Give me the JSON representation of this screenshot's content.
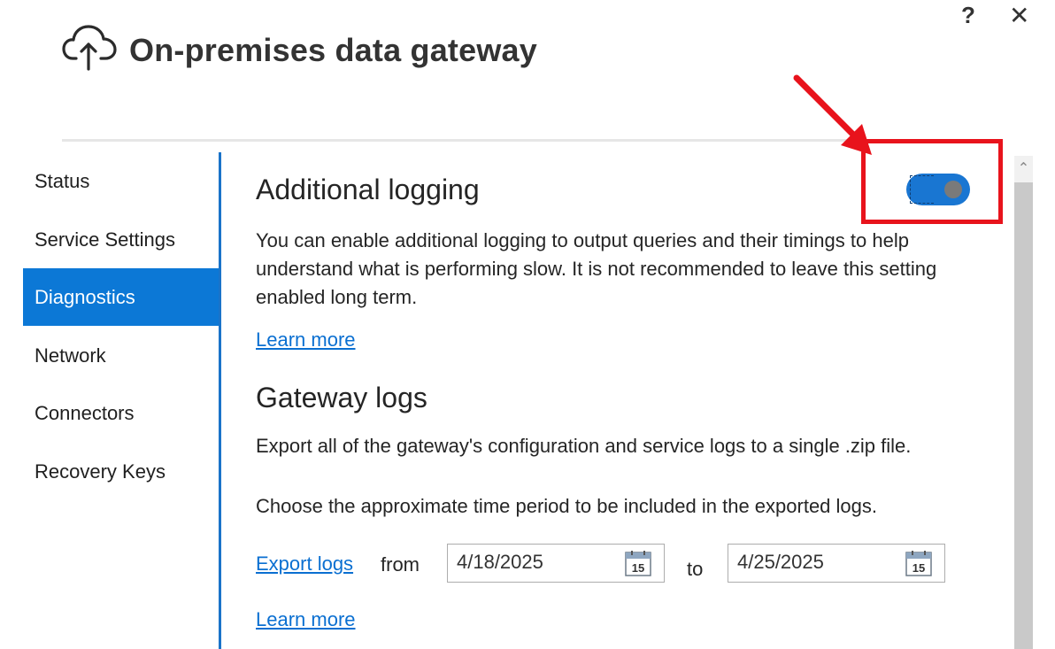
{
  "window": {
    "help_glyph": "?",
    "close_glyph": "✕"
  },
  "header": {
    "title": "On-premises data gateway",
    "icon": "cloud-upload-icon"
  },
  "sidebar": {
    "items": [
      {
        "label": "Status"
      },
      {
        "label": "Service Settings"
      },
      {
        "label": "Diagnostics",
        "active": true
      },
      {
        "label": "Network"
      },
      {
        "label": "Connectors"
      },
      {
        "label": "Recovery Keys"
      }
    ]
  },
  "additional_logging": {
    "title": "Additional logging",
    "description": "You can enable additional logging to output queries and their timings to help understand what is performing slow. It is not recommended to leave this setting enabled long term.",
    "learn_more": "Learn more",
    "toggle_on": true
  },
  "gateway_logs": {
    "title": "Gateway logs",
    "description": "Export all of the gateway's configuration and service logs to a single .zip file.",
    "period_hint": "Choose the approximate time period to be included in the exported logs.",
    "export_link": "Export logs",
    "from_label": "from",
    "from_date": "4/18/2025",
    "to_label": "to",
    "to_date": "4/25/2025",
    "calendar_day": "15",
    "learn_more": "Learn more"
  },
  "colors": {
    "accent": "#0c78d6",
    "link": "#0a6fd1",
    "annotation": "#e8131c"
  }
}
